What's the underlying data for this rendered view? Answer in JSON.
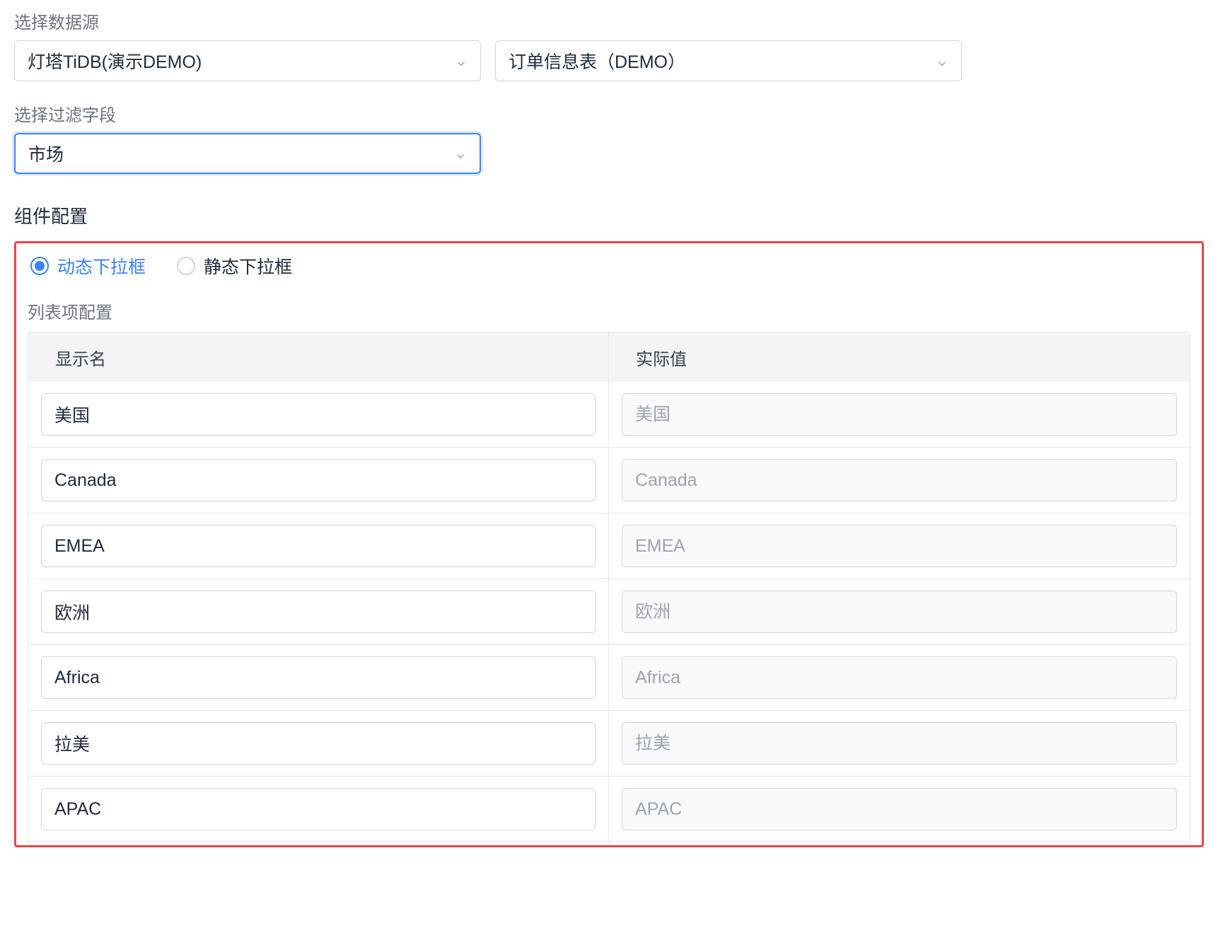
{
  "datasource": {
    "label": "选择数据源",
    "primary_value": "灯塔TiDB(演示DEMO)",
    "secondary_value": "订单信息表（DEMO）"
  },
  "filter_field": {
    "label": "选择过滤字段",
    "value": "市场"
  },
  "component_config": {
    "title": "组件配置",
    "radio_options": {
      "dynamic": "动态下拉框",
      "static": "静态下拉框"
    },
    "list_label": "列表项配置",
    "table_header": {
      "display": "显示名",
      "actual": "实际值"
    },
    "rows": [
      {
        "display": "美国",
        "actual": "美国"
      },
      {
        "display": "Canada",
        "actual": "Canada"
      },
      {
        "display": "EMEA",
        "actual": "EMEA"
      },
      {
        "display": "欧洲",
        "actual": "欧洲"
      },
      {
        "display": "Africa",
        "actual": "Africa"
      },
      {
        "display": "拉美",
        "actual": "拉美"
      },
      {
        "display": "APAC",
        "actual": "APAC"
      }
    ]
  }
}
